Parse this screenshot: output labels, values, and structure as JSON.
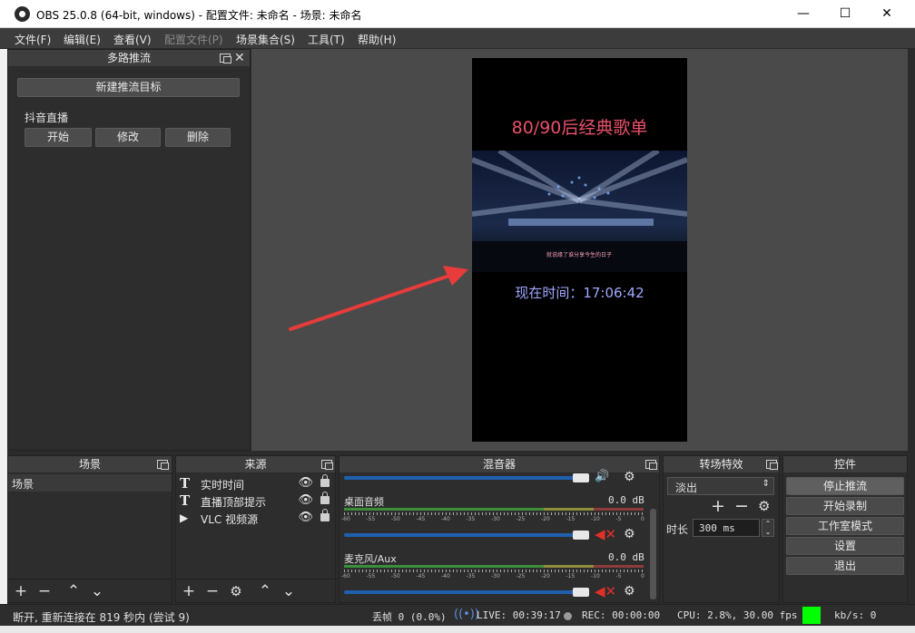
{
  "window": {
    "title": "OBS 25.0.8 (64-bit, windows) - 配置文件: 未命名 - 场景: 未命名",
    "minimize": "—",
    "maximize": "☐",
    "close": "✕"
  },
  "menu": {
    "items": [
      "文件(F)",
      "编辑(E)",
      "查看(V)",
      "配置文件(P)",
      "场景集合(S)",
      "工具(T)",
      "帮助(H)"
    ]
  },
  "multistream": {
    "title": "多路推流",
    "new_target": "新建推流目标",
    "target_name": "抖音直播",
    "start": "开始",
    "edit": "修改",
    "delete": "删除"
  },
  "preview": {
    "headline": "80/90后经典歌单",
    "subtitle_lyric": "就说缘了谁分享今生的日子",
    "time_label": "现在时间：17:06:42"
  },
  "scenes": {
    "title": "场景",
    "items": [
      "场景"
    ]
  },
  "sources": {
    "title": "来源",
    "items": [
      {
        "label": "实时时间",
        "icon": "text-icon"
      },
      {
        "label": "直播顶部提示",
        "icon": "text-icon"
      },
      {
        "label": "VLC 视频源",
        "icon": "play-icon"
      }
    ]
  },
  "mixer": {
    "title": "混音器",
    "channels": [
      {
        "name": "桌面音频",
        "db": "0.0 dB",
        "muted": true
      },
      {
        "name": "麦克风/Aux",
        "db": "0.0 dB",
        "muted": true
      }
    ],
    "ticks": [
      "-60",
      "-55",
      "-50",
      "-45",
      "-40",
      "-35",
      "-30",
      "-25",
      "-20",
      "-15",
      "-10",
      "-5",
      "0"
    ]
  },
  "transitions": {
    "title": "转场特效",
    "selected": "淡出",
    "duration_label": "时长",
    "duration_value": "300 ms"
  },
  "controls": {
    "title": "控件",
    "stop_stream": "停止推流",
    "start_record": "开始录制",
    "studio_mode": "工作室模式",
    "settings": "设置",
    "exit": "退出"
  },
  "status": {
    "reconnect": "断开, 重新连接在 819 秒内 (尝试 9)",
    "dropped": "丢帧 0 (0.0%)",
    "live": "LIVE: 00:39:17",
    "rec": "REC: 00:00:00",
    "cpu": "CPU: 2.8%, 30.00 fps",
    "kbs": "kb/s: 0",
    "status_color": "#00ff00"
  },
  "colors": {
    "headline": "#e8506a",
    "time_text": "#a0a8ff",
    "arrow": "#e83c3c",
    "slider": "#2f7fe0"
  }
}
